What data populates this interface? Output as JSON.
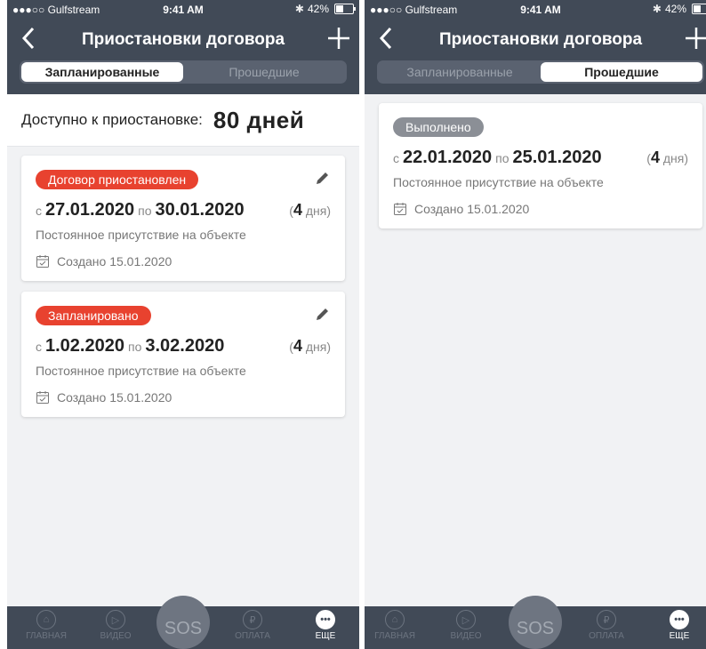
{
  "status": {
    "carrier": "●●●○○ Gulfstream",
    "time": "9:41 AM",
    "battery": "42%",
    "battery_level": 0.42
  },
  "nav": {
    "title": "Приостановки договора"
  },
  "tabs": {
    "planned": "Запланированные",
    "past": "Прошедшие"
  },
  "left": {
    "available_label": "Доступно к приостановке:",
    "available_value": "80 дней",
    "cards": [
      {
        "badge": "Договор приостановлен",
        "from_label": "с",
        "from": "27.01.2020",
        "to_label": "по",
        "to": "30.01.2020",
        "duration_num": "4",
        "duration_unit": "дня",
        "note": "Постоянное присутствие на объекте",
        "created": "Создано 15.01.2020"
      },
      {
        "badge": "Запланировано",
        "from_label": "с",
        "from": "1.02.2020",
        "to_label": "по",
        "to": "3.02.2020",
        "duration_num": "4",
        "duration_unit": "дня",
        "note": "Постоянное присутствие на объекте",
        "created": "Создано 15.01.2020"
      }
    ]
  },
  "right": {
    "cards": [
      {
        "badge": "Выполнено",
        "from_label": "с",
        "from": "22.01.2020",
        "to_label": "по",
        "to": "25.01.2020",
        "duration_num": "4",
        "duration_unit": "дня",
        "note": "Постоянное присутствие на объекте",
        "created": "Создано 15.01.2020"
      }
    ]
  },
  "tabbar": {
    "home": "ГЛАВНАЯ",
    "video": "ВИДЕО",
    "sos": "SOS",
    "payment": "ОПЛАТА",
    "more": "ЕЩЕ"
  },
  "colors": {
    "navbar": "#414a57",
    "red_badge": "#e8422f",
    "grey_badge": "#8b8f96"
  }
}
